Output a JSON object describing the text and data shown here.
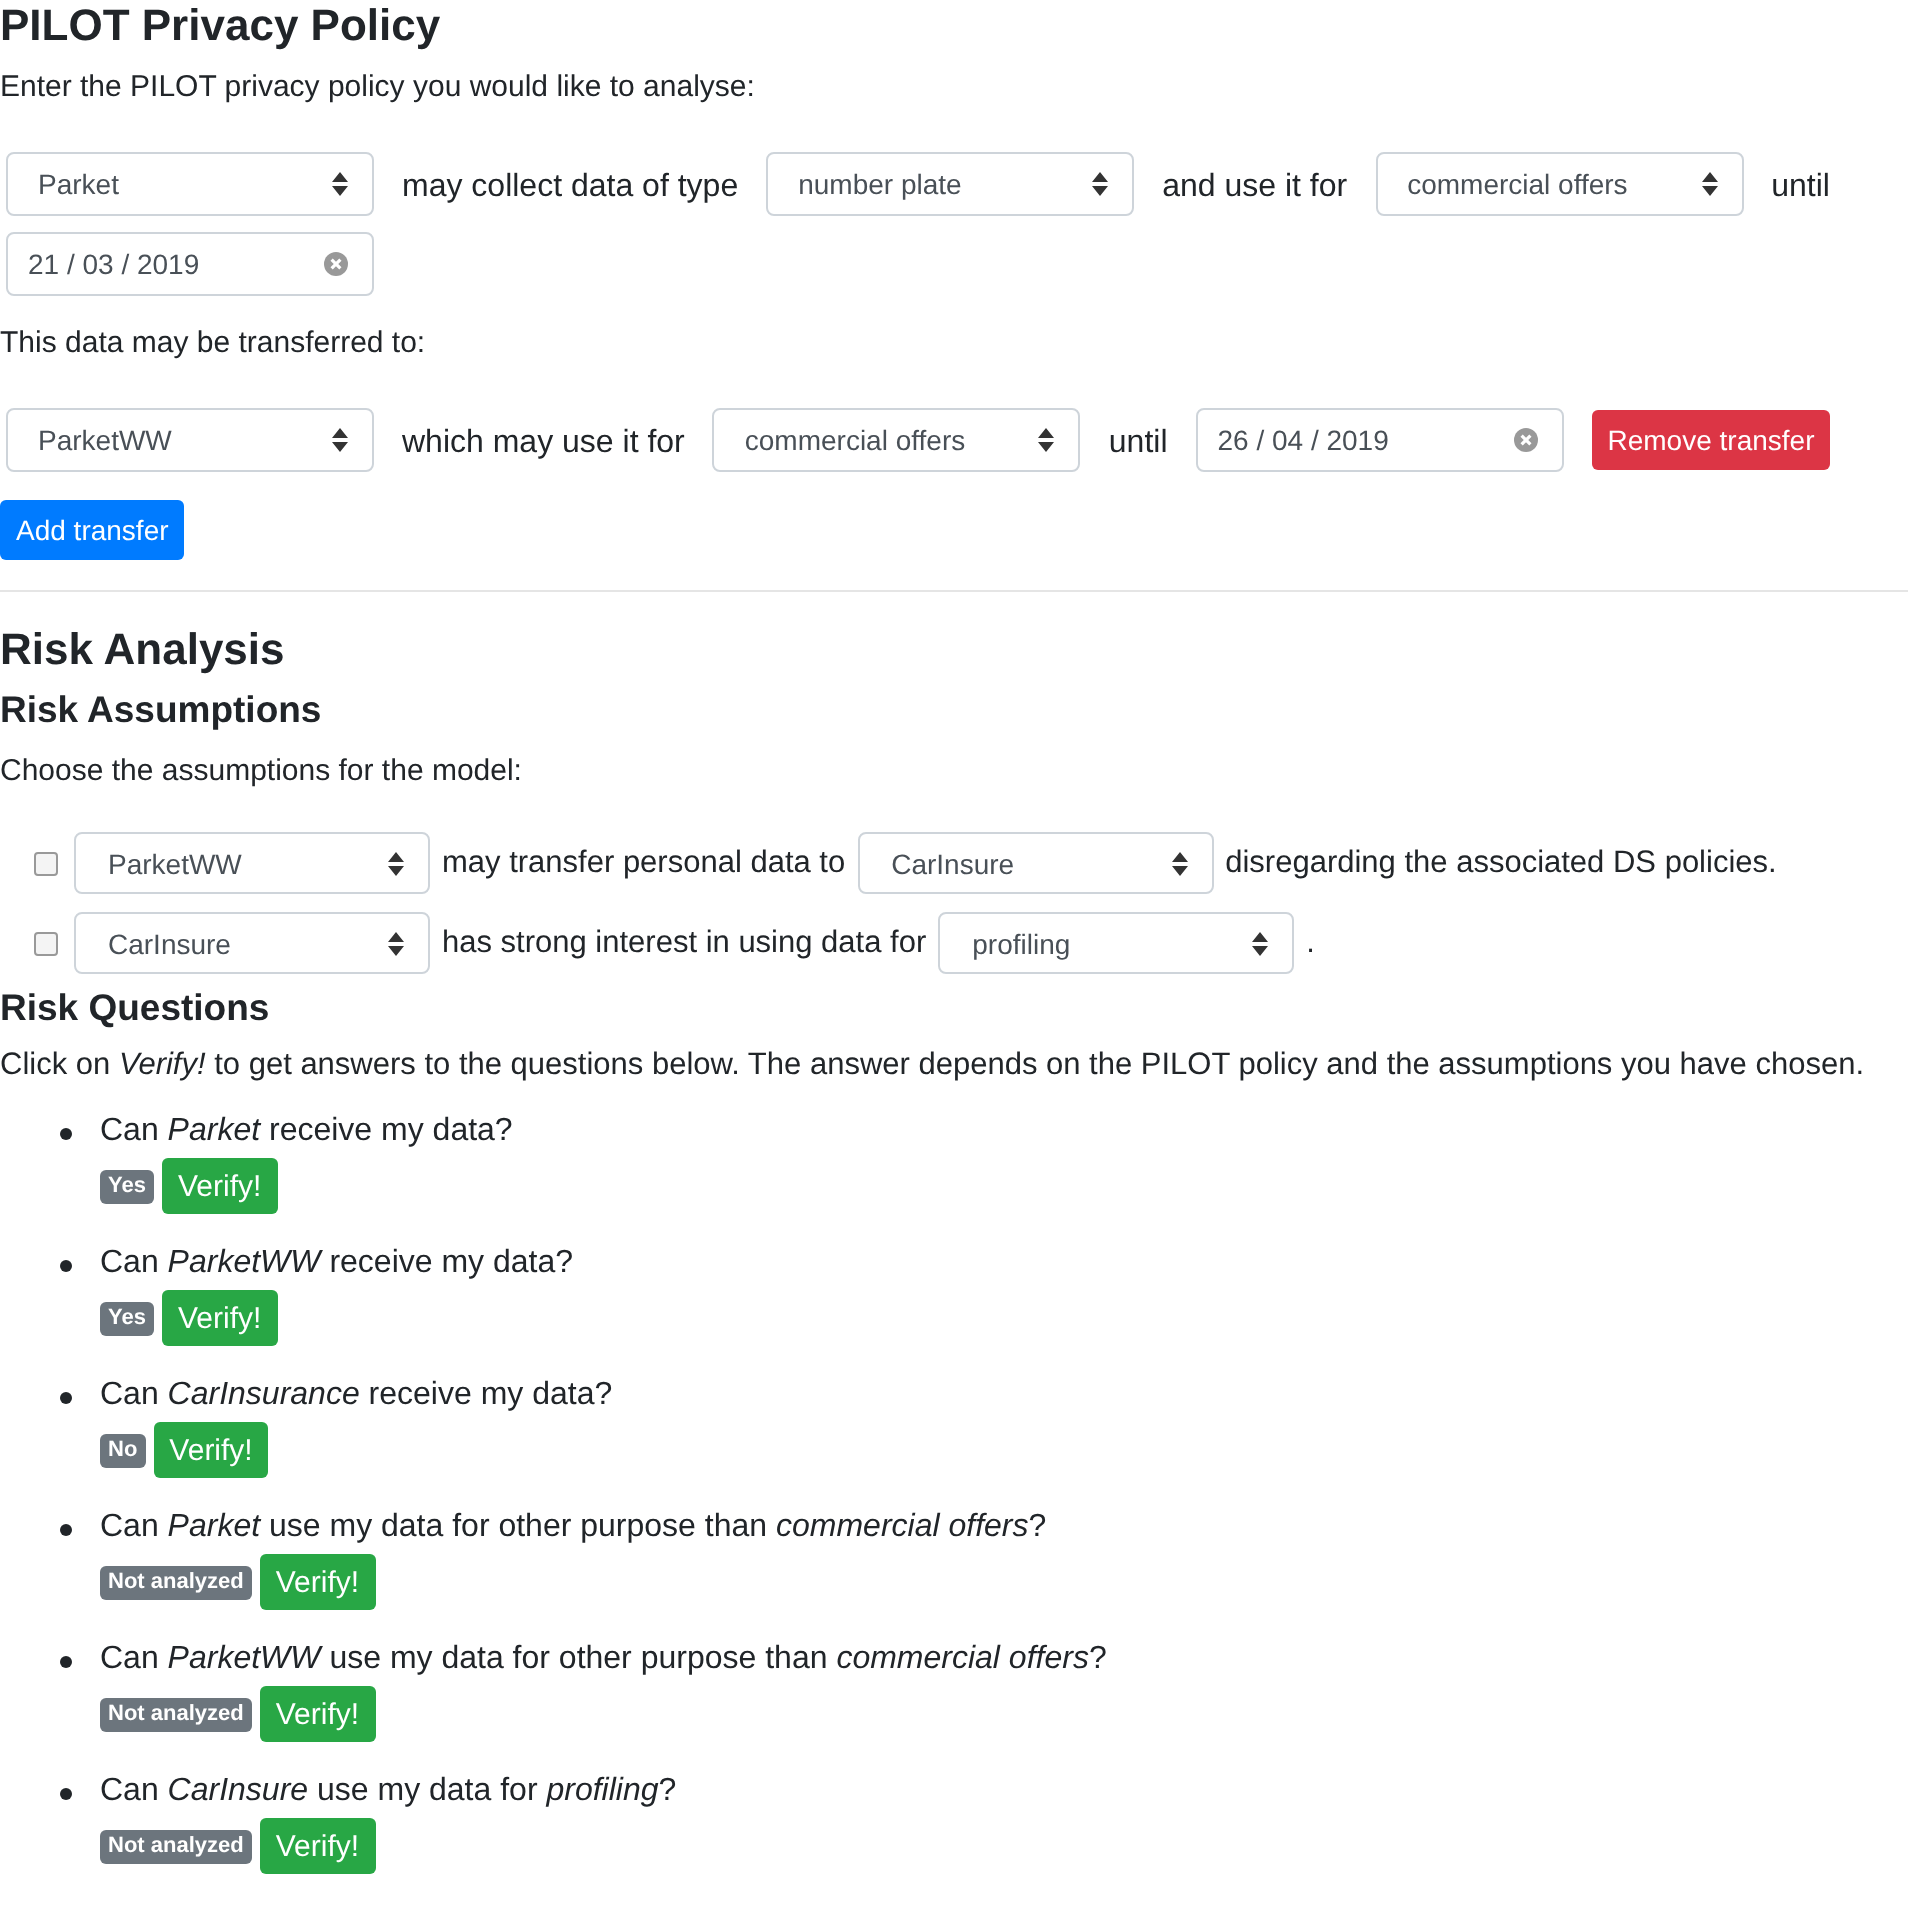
{
  "policy": {
    "title": "PILOT Privacy Policy",
    "intro": "Enter the PILOT privacy policy you would like to analyse:",
    "collect_row": [
      {
        "kind": "select",
        "value": "Parket"
      },
      {
        "kind": "text",
        "text": "may collect data of type"
      },
      {
        "kind": "select",
        "value": "number plate"
      },
      {
        "kind": "text",
        "text": "and use it for"
      },
      {
        "kind": "select",
        "value": "commercial offers"
      },
      {
        "kind": "text",
        "text": "until"
      },
      {
        "kind": "date",
        "value": "21 / 03 / 2019"
      }
    ],
    "transfer_label": "This data may be transferred to:",
    "transfers": [
      [
        {
          "kind": "select",
          "value": "ParketWW"
        },
        {
          "kind": "text",
          "text": "which may use it for"
        },
        {
          "kind": "select",
          "value": "commercial offers"
        },
        {
          "kind": "text",
          "text": "until"
        },
        {
          "kind": "date",
          "value": "26 / 04 / 2019"
        },
        {
          "kind": "danger",
          "text": "Remove transfer"
        }
      ]
    ],
    "add_button": "Add transfer"
  },
  "risk": {
    "title": "Risk Analysis",
    "assumptions_title": "Risk Assumptions",
    "assumptions_intro": "Choose the assumptions for the model:",
    "assumptions": [
      {
        "checked": false,
        "parts": [
          {
            "kind": "select",
            "value": "ParketWW"
          },
          {
            "kind": "text",
            "text": "may transfer personal data to"
          },
          {
            "kind": "select",
            "value": "CarInsure"
          },
          {
            "kind": "text",
            "text": "disregarding the associated DS policies."
          }
        ]
      },
      {
        "checked": false,
        "parts": [
          {
            "kind": "select",
            "value": "CarInsure"
          },
          {
            "kind": "text",
            "text": "has strong interest in using data for"
          },
          {
            "kind": "select",
            "value": "profiling"
          },
          {
            "kind": "text",
            "text": "."
          }
        ]
      }
    ],
    "questions_title": "Risk Questions",
    "questions_intro": "Click on *Verify!* to get answers to the questions below. The answer depends on the PILOT policy and the assumptions you have chosen.",
    "questions": [
      {
        "text": "Can *Parket* receive my data?",
        "answer": "Yes",
        "button": "Verify!"
      },
      {
        "text": "Can *ParketWW* receive my data?",
        "answer": "Yes",
        "button": "Verify!"
      },
      {
        "text": "Can *CarInsurance* receive my data?",
        "answer": "No",
        "button": "Verify!"
      },
      {
        "text": "Can *Parket* use my data for other purpose than *commercial offers*?",
        "answer": "Not analyzed",
        "button": "Verify!"
      },
      {
        "text": "Can *ParketWW* use my data for other purpose than *commercial offers*?",
        "answer": "Not analyzed",
        "button": "Verify!"
      },
      {
        "text": "Can *CarInsure* use my data for *profiling*?",
        "answer": "Not analyzed",
        "button": "Verify!"
      }
    ]
  }
}
